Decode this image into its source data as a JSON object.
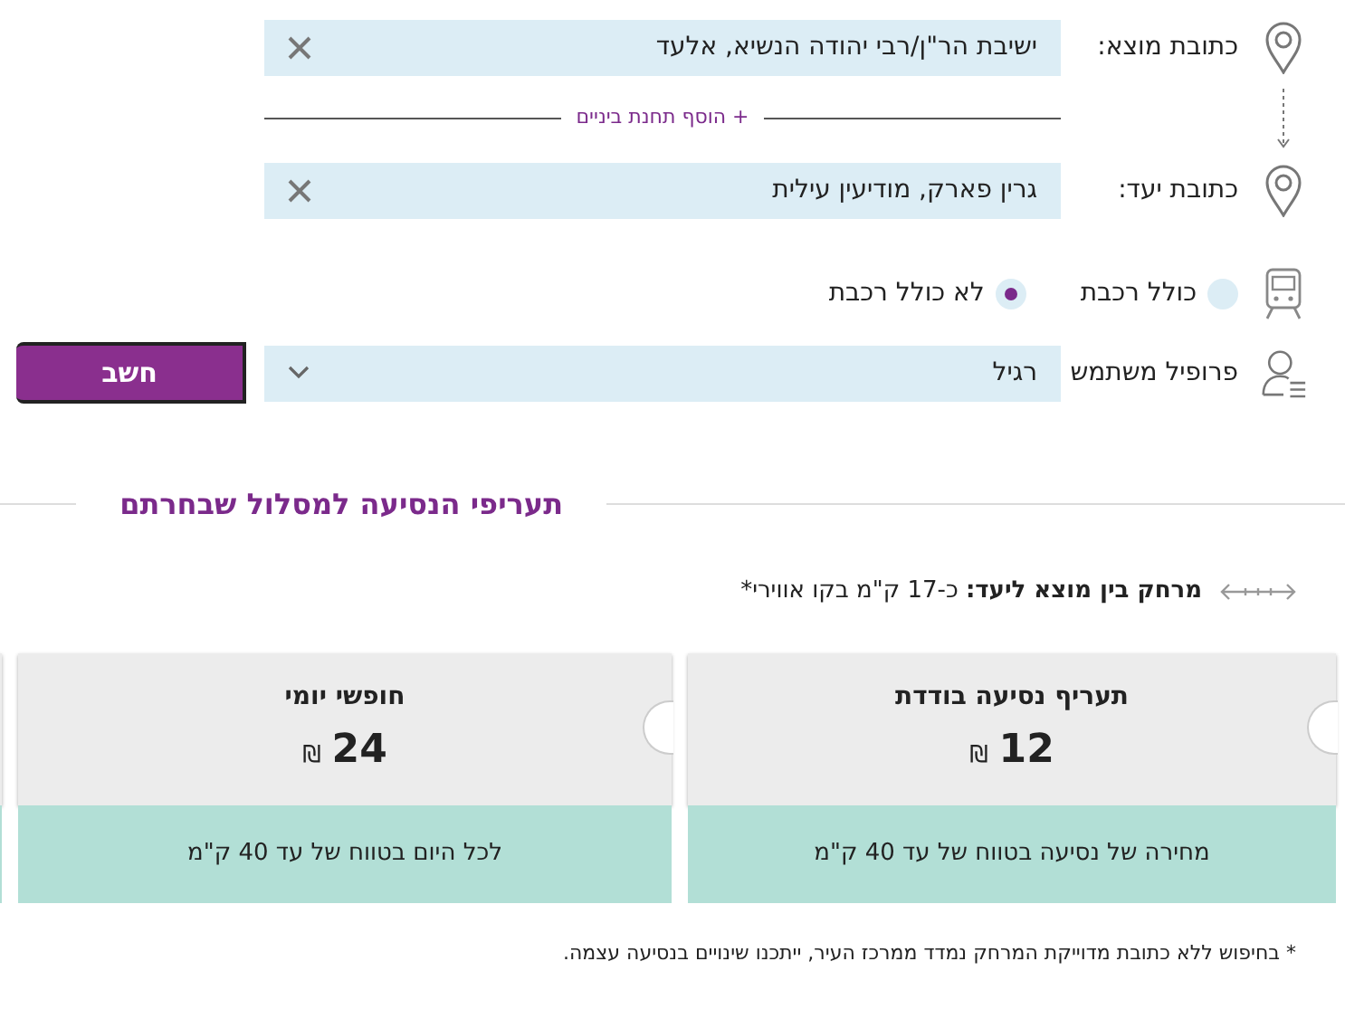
{
  "origin": {
    "label": "כתובת מוצא:",
    "value": "ישיבת הר\"ן/רבי יהודה הנשיא, אלעד"
  },
  "add_stop": "+ הוסף תחנת ביניים",
  "destination": {
    "label": "כתובת יעד:",
    "value": "גרין פארק, מודיעין עילית"
  },
  "train_options": [
    {
      "label": "כולל רכבת",
      "selected": false
    },
    {
      "label": "לא כולל רכבת",
      "selected": true
    }
  ],
  "profile": {
    "label": "פרופיל משתמש",
    "value": "רגיל"
  },
  "calculate_button": "חשב",
  "section_title": "תעריפי הנסיעה למסלול שבחרתם",
  "distance": "**מרחק בין מוצא ליעד:** כ-17 ק\"מ בקו אווירי*",
  "fares": [
    {
      "title": "תעריף נסיעה בודדת",
      "price": "12",
      "currency": "₪",
      "note": "מחירה של נסיעה בטווח של עד 40 ק\"מ"
    },
    {
      "title": "חופשי יומי",
      "price": "24",
      "currency": "₪",
      "note": "לכל היום בטווח של עד 40 ק\"מ"
    }
  ],
  "footnote": "* בחיפוש ללא כתובת מדוייקת המרחק נמדד ממרכז העיר, ייתכנו שינויים בנסיעה עצמה."
}
